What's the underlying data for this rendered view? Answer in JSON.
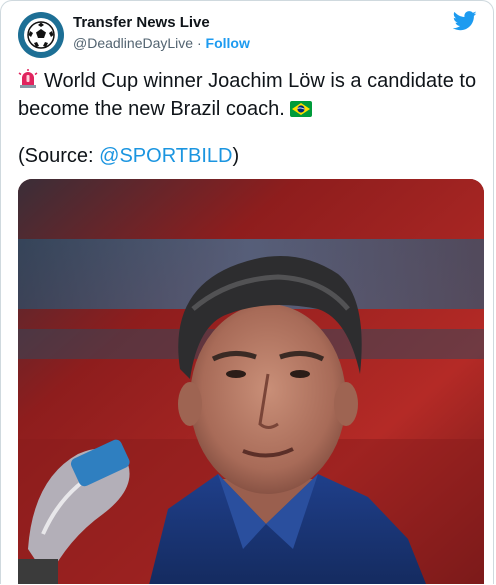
{
  "account": {
    "name": "Transfer News Live",
    "handle": "@DeadlineDayLive",
    "separator": " · ",
    "follow_label": "Follow"
  },
  "tweet": {
    "text_line": "World Cup winner Joachim Löw is a candidate to become the new Brazil coach.",
    "source_prefix": "(Source: ",
    "source_mention": "@SPORTBILD",
    "source_suffix": ")"
  },
  "icons": {
    "header": "twitter-bird-icon",
    "alarm": "rotating-light-emoji",
    "flag": "brazil-flag-emoji"
  },
  "colors": {
    "link": "#1d9bf0",
    "text": "#0f1419",
    "muted": "#536471",
    "avatar_ring": "#1d6f95"
  }
}
